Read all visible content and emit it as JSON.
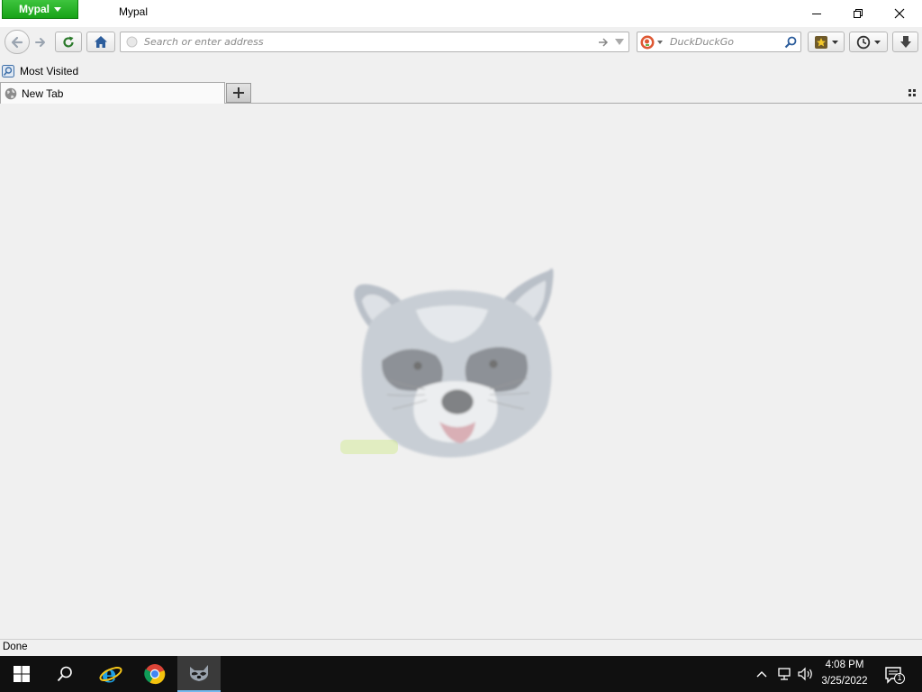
{
  "window": {
    "app_menu_label": "Mypal",
    "title": "Mypal",
    "controls": [
      "minimize-icon",
      "restore-icon",
      "close-icon"
    ]
  },
  "navbar": {
    "url_placeholder": "Search or enter address",
    "search_placeholder": "DuckDuckGo",
    "buttons": [
      "back-icon",
      "forward-icon",
      "reload-icon",
      "home-icon",
      "go-arrow-icon",
      "dropmarker-icon",
      "search-engine-icon",
      "search-icon",
      "bookmarks-menu-icon",
      "history-icon",
      "downloads-icon"
    ]
  },
  "bookmarks_toolbar": {
    "items": [
      {
        "label": "Most Visited",
        "icon": "most-visited-icon"
      }
    ]
  },
  "tabs": [
    {
      "label": "New Tab",
      "icon": "globe-icon",
      "active": true
    }
  ],
  "content": {
    "logo_icon": "raccoon-mascot-icon"
  },
  "status": {
    "text": "Done"
  },
  "taskbar": {
    "apps": [
      "windows-start-icon",
      "search-icon",
      "internet-explorer-icon",
      "chrome-icon",
      "mypal-raccoon-icon"
    ],
    "tray": [
      "chevron-up-icon",
      "network-icon",
      "volume-icon",
      "notification-icon"
    ],
    "clock_time": "4:08 PM",
    "clock_date": "3/25/2022",
    "notification_count": "1"
  },
  "colors": {
    "accent_green": "#17a317",
    "taskbar": "#101010",
    "content_bg": "#f0f0f0"
  }
}
